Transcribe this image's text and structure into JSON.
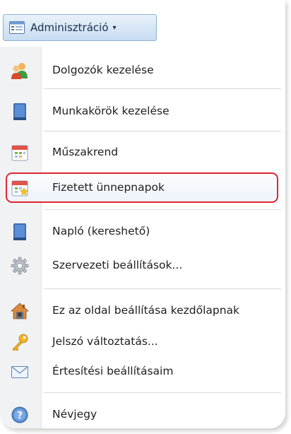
{
  "menubar": {
    "button_label": "Adminisztráció",
    "button_icon": "window-list-icon",
    "dropdown_arrow": "▾"
  },
  "menu": {
    "items": [
      {
        "label": "Dolgozók kezelése",
        "icon": "users-icon"
      },
      {
        "label": "Munkakörök kezelése",
        "icon": "book-icon"
      },
      {
        "label": "Műszakrend",
        "icon": "calendar-icon"
      },
      {
        "label": "Fizetett ünnepnapok",
        "icon": "calendar-star-icon",
        "highlighted": true
      },
      {
        "label": "Napló (kereshető)",
        "icon": "book-icon"
      },
      {
        "label": "Szervezeti beállítások...",
        "icon": "gear-icon"
      },
      {
        "label": "Ez az oldal beállítása kezdőlapnak",
        "icon": "home-icon"
      },
      {
        "label": "Jelszó változtatás...",
        "icon": "key-icon"
      },
      {
        "label": "Értesítési beállításaim",
        "icon": "envelope-icon"
      },
      {
        "label": "Névjegy",
        "icon": "info-icon"
      }
    ]
  },
  "colors": {
    "highlight_border": "#e0262f",
    "menu_button_border": "#8fb2d6"
  }
}
